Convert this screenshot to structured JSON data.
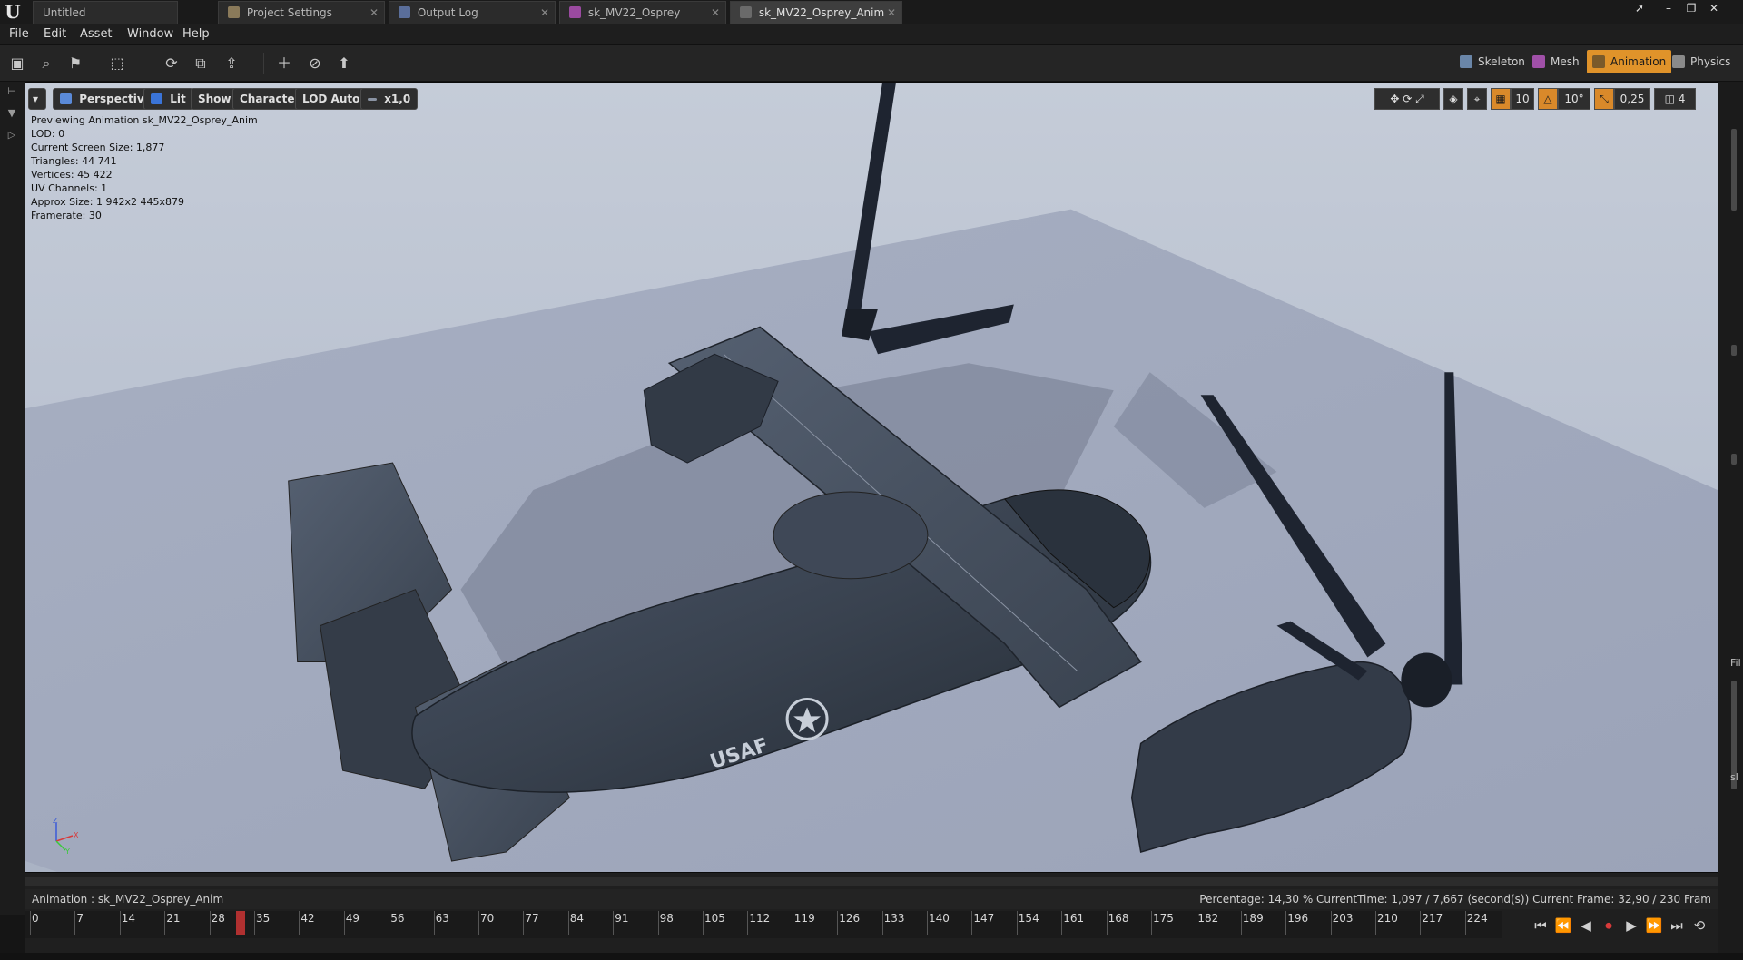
{
  "tabs": [
    {
      "label": "Untitled",
      "active": false
    },
    {
      "label": "Project Settings",
      "active": false
    },
    {
      "label": "Output Log",
      "active": false
    },
    {
      "label": "sk_MV22_Osprey",
      "active": false
    },
    {
      "label": "sk_MV22_Osprey_Anim",
      "active": true
    }
  ],
  "menu": [
    "File",
    "Edit",
    "Asset",
    "Window",
    "Help"
  ],
  "modes": [
    {
      "label": "Skeleton",
      "icon": "skeleton-icon",
      "active": false
    },
    {
      "label": "Mesh",
      "icon": "mesh-icon",
      "active": false
    },
    {
      "label": "Animation",
      "icon": "animation-icon",
      "active": true
    },
    {
      "label": "Physics",
      "icon": "physics-icon",
      "active": false
    }
  ],
  "viewport_toolbar": {
    "perspective": "Perspective",
    "lit": "Lit",
    "show": "Show",
    "character": "Character",
    "lod": "LOD Auto",
    "speed": "x1,0",
    "grid_snap": "10",
    "rotation_snap": "10°",
    "scale_snap": "0,25",
    "camera_speed": "4"
  },
  "stats": [
    "Previewing Animation sk_MV22_Osprey_Anim",
    "LOD: 0",
    "Current Screen Size: 1,877",
    "Triangles: 44 741",
    "Vertices: 45 422",
    "UV Channels: 1",
    "Approx Size: 1 942x2 445x879",
    "Framerate: 30"
  ],
  "aircraft_marking": "USAF",
  "right_panel": {
    "fi": "Fil",
    "sl": "sl"
  },
  "timeline": {
    "animation_label": "Animation :  sk_MV22_Osprey_Anim",
    "stats": "Percentage:  14,30 % CurrentTime:  1,097 / 7,667 (second(s)) Current Frame:  32,90 / 230 Fram",
    "ticks": [
      "0",
      "7",
      "14",
      "21",
      "28",
      "35",
      "42",
      "49",
      "56",
      "63",
      "70",
      "77",
      "84",
      "91",
      "98",
      "105",
      "112",
      "119",
      "126",
      "133",
      "140",
      "147",
      "154",
      "161",
      "168",
      "175",
      "182",
      "189",
      "196",
      "203",
      "210",
      "217",
      "224"
    ],
    "current_frame": 32.9,
    "total_frames": 230
  },
  "colors": {
    "accent": "#e0932a",
    "scrub": "#b03030",
    "sky": "#c5ccd8"
  }
}
